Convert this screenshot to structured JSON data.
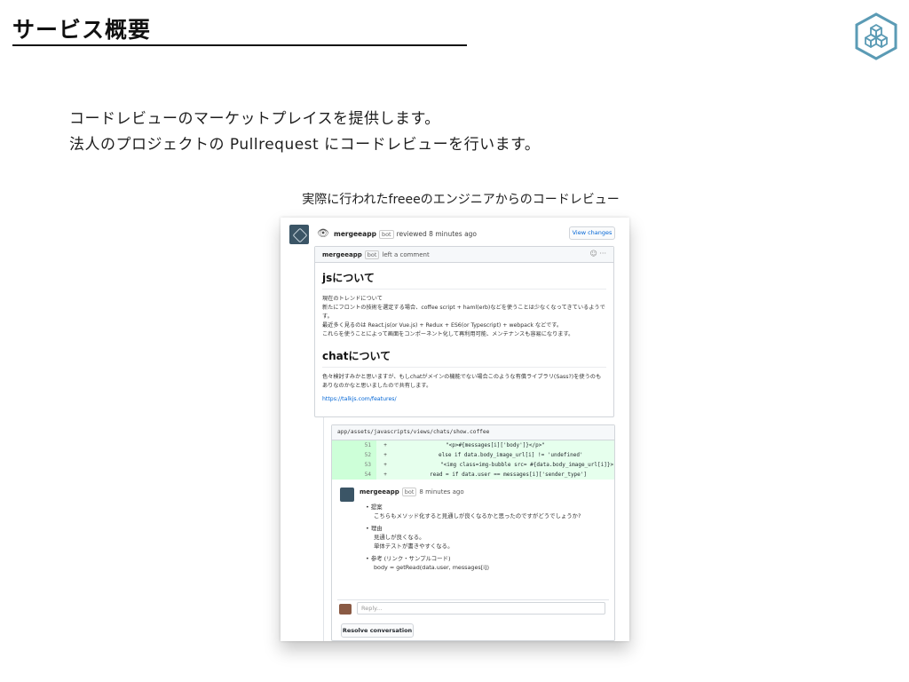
{
  "slide": {
    "title": "サービス概要",
    "line1": "コードレビューのマーケットプレイスを提供します。",
    "line2": "法人のプロジェクトの Pullrequest にコードレビューを行います。",
    "caption": "実際に行われたfreeeのエンジニアからのコードレビュー"
  },
  "screenshot": {
    "review": {
      "user": "mergeeapp",
      "badge": "bot",
      "text": "reviewed 8 minutes ago",
      "view_changes": "View changes"
    },
    "comment": {
      "user": "mergeeapp",
      "badge": "bot",
      "text": "left a comment",
      "menu": "☺ ···",
      "heading_js": "jsについて",
      "js_paragraph": [
        "現在のトレンドについて",
        "新たにフロントの技術を選定する場合、coffee script + haml(erb)などを使うことは少なくなってきているようです。",
        "最近多く見るのは React.js(or Vue.js) + Redux + ES6(or Typescript) + webpack などです。",
        "これらを使うことによって画面をコンポーネント化して再利用可能、メンテナンスも容易になります。"
      ],
      "heading_chat": "chatについて",
      "chat_paragraph": [
        "色々検討すみかと思いますが、もしchatがメインの機能でない場合このような有償ライブラリ(Sass?)を使うのもありなのかなと思いましたので共有します。"
      ],
      "link": "https://talkjs.com/features/"
    },
    "thread": {
      "file_path": "app/assets/javascripts/views/chats/show.coffee",
      "diff": [
        {
          "line": "51",
          "sign": "+",
          "code": "\"<p>#{messages[i]['body']}</p>\""
        },
        {
          "line": "52",
          "sign": "+",
          "code": "else if data.body_image_url[i] != 'undefined'"
        },
        {
          "line": "53",
          "sign": "+",
          "code": "\"<img class=img-bubble src= #{data.body_image_url[i]}>\""
        },
        {
          "line": "54",
          "sign": "+",
          "code": "read = if data.user == messages[i]['sender_type']"
        }
      ],
      "reply": {
        "user": "mergeeapp",
        "badge": "bot",
        "time": "8 minutes ago",
        "bullets": [
          {
            "head": "提案",
            "lines": [
              "こちらもメソッド化すると見通しが良くなるかと思ったのですがどうでしょうか?"
            ]
          },
          {
            "head": "理由",
            "lines": [
              "見通しが良くなる。",
              "単体テストが書きやすくなる。"
            ]
          },
          {
            "head": "参考 (リンク・サンプルコード)",
            "lines": [
              "body = getRead(data.user, messages[i])"
            ]
          }
        ]
      },
      "reply_placeholder": "Reply...",
      "resolve_label": "Resolve conversation"
    }
  }
}
